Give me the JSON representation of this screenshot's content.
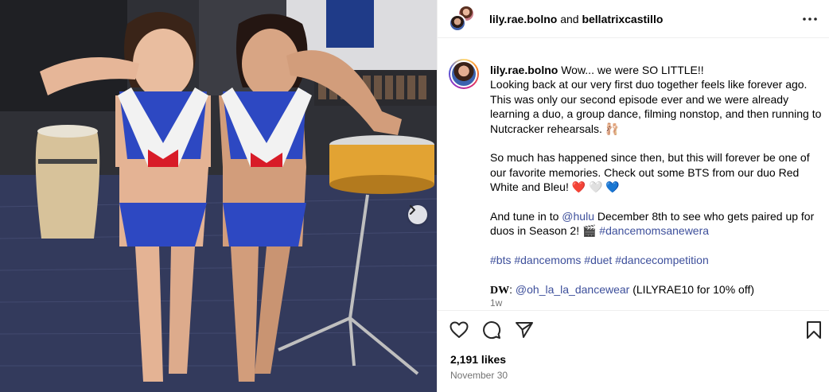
{
  "header": {
    "user1": "lily.rae.bolno",
    "connector": "and",
    "user2": "bellatrixcastillo"
  },
  "caption": {
    "username": "lily.rae.bolno",
    "line1": "Wow... we were SO LITTLE!!",
    "para1": "Looking back at our very first duo together feels like forever ago. This was only our second episode ever and we were already learning a duo, a group dance, filming nonstop, and then running to Nutcracker rehearsals. 🩰",
    "para2": "So much has happened since then, but this will forever be one of our favorite memories. Check out some BTS from our duo Red White and Bleu! ❤️ 🤍 💙",
    "para3_a": "And tune in to ",
    "para3_mention": "@hulu",
    "para3_b": " December 8th to see who gets paired up for duos in Season 2! 🎬 ",
    "para3_tag": "#dancemomsanewera",
    "hashtags": "#bts #dancemoms #duet #dancecompetition",
    "dw_label": "DW",
    "dw_sep": ": ",
    "dw_mention": "@oh_la_la_dancewear",
    "dw_rest": " (LILYRAE10 for 10% off)",
    "time": "1w"
  },
  "stats": {
    "likes": "2,191 likes",
    "date": "November 30"
  },
  "icons": {
    "more": "more-options-icon",
    "like": "heart-icon",
    "comment": "comment-icon",
    "share": "send-icon",
    "save": "bookmark-icon",
    "next": "chevron-right-icon"
  },
  "colors": {
    "link": "#3d4f9b",
    "muted": "#737373",
    "border": "#efefef"
  }
}
